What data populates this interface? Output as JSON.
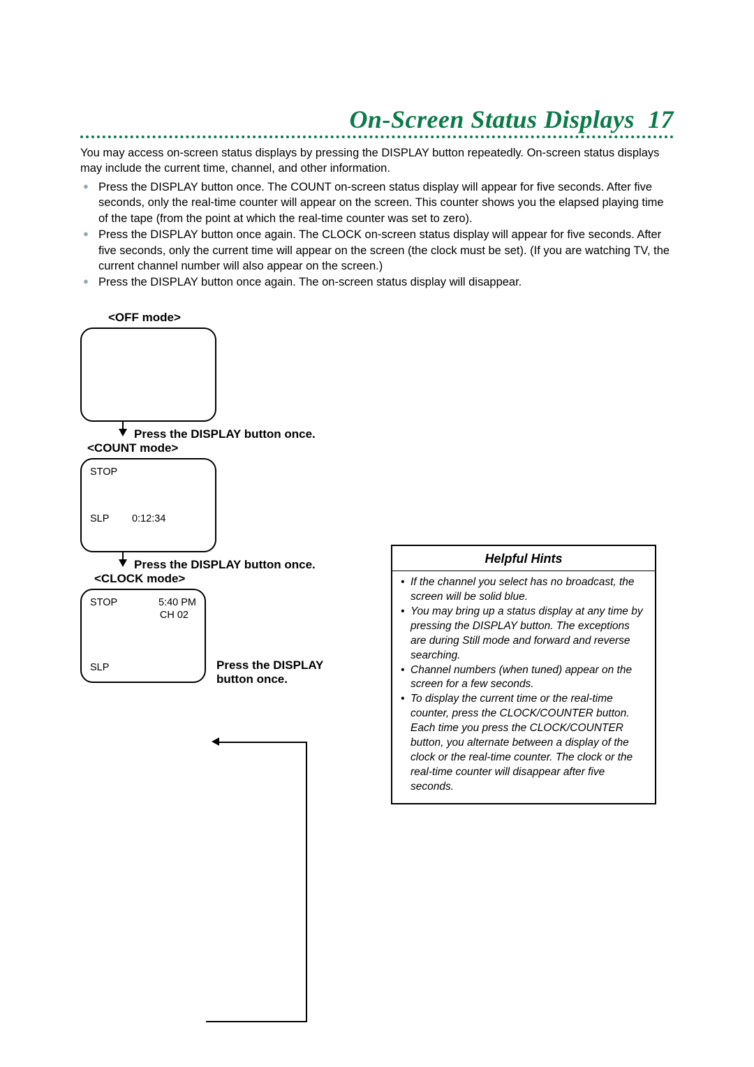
{
  "title": "On-Screen Status Displays",
  "page_number": "17",
  "intro": "You may access on-screen status displays by pressing the DISPLAY button repeatedly. On-screen status displays may include the current time, channel, and other information.",
  "bullets": [
    "Press the DISPLAY button once. The COUNT on-screen status display will appear for five seconds. After five seconds, only the real-time counter will appear on the screen. This counter shows you the elapsed playing time of the tape (from the point at which the real-time counter was set to zero).",
    "Press the DISPLAY button once again. The CLOCK on-screen status display will appear for five seconds. After five seconds, only the current time will appear on the screen (the clock must be set). (If you are watching TV, the current channel number will also appear on the screen.)",
    "Press the DISPLAY button once again. The on-screen status display will disappear."
  ],
  "diagram": {
    "off_label": "<OFF mode>",
    "count_label": "<COUNT mode>",
    "clock_label": "<CLOCK mode>",
    "press_once": "Press the DISPLAY button once.",
    "press_once_multiline": "Press the DISPLAY button once.",
    "count": {
      "top_left": "STOP",
      "bottom_left": "SLP",
      "bottom_center": "0:12:34"
    },
    "clock": {
      "top_left": "STOP",
      "top_right1": "5:40 PM",
      "top_right2": "CH 02",
      "bottom_left": "SLP"
    }
  },
  "hints": {
    "title": "Helpful Hints",
    "items": [
      "If the channel you select has no broadcast, the screen will be solid blue.",
      "You may bring up a status display at any time by pressing the DISPLAY button. The exceptions are during Still mode and forward and reverse searching.",
      "Channel numbers (when tuned) appear on the screen for a few seconds.",
      "To display the current time or the real-time counter, press the CLOCK/COUNTER button.  Each time you press the CLOCK/COUNTER button, you alternate between a display of the clock or the real-time counter.  The clock or the real-time counter will disappear after five seconds."
    ]
  }
}
